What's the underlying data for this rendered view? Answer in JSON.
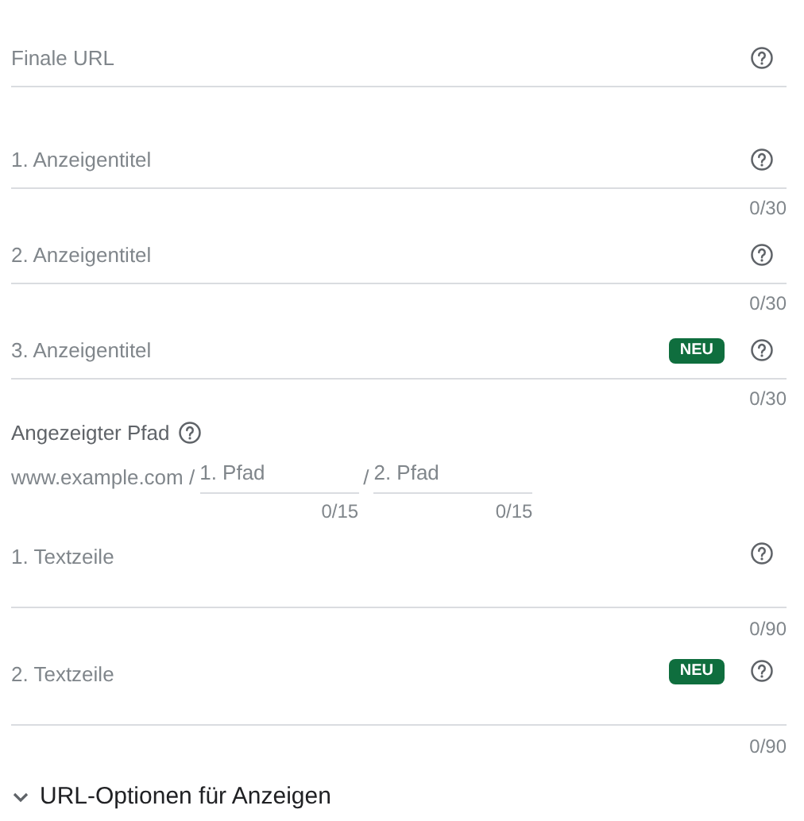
{
  "fields": [
    {
      "kind": "line",
      "placeholder": "Finale URL"
    },
    {
      "kind": "line",
      "placeholder": "1. Anzeigentitel",
      "counter": "0/30"
    },
    {
      "kind": "line",
      "placeholder": "2. Anzeigentitel",
      "counter": "0/30"
    },
    {
      "kind": "line",
      "placeholder": "3. Anzeigentitel",
      "counter": "0/30",
      "badge": "NEU"
    }
  ],
  "display_path": {
    "label": "Angezeigter Pfad",
    "domain": "www.example.com /",
    "separator": "/",
    "paths": [
      {
        "placeholder": "1. Pfad",
        "counter": "0/15"
      },
      {
        "placeholder": "2. Pfad",
        "counter": "0/15"
      }
    ]
  },
  "descriptions": [
    {
      "kind": "area",
      "placeholder": "1. Textzeile",
      "counter": "0/90"
    },
    {
      "kind": "area",
      "placeholder": "2. Textzeile",
      "counter": "0/90",
      "badge": "NEU"
    }
  ],
  "url_options": {
    "label": "URL-Optionen für Anzeigen",
    "expanded": false
  }
}
